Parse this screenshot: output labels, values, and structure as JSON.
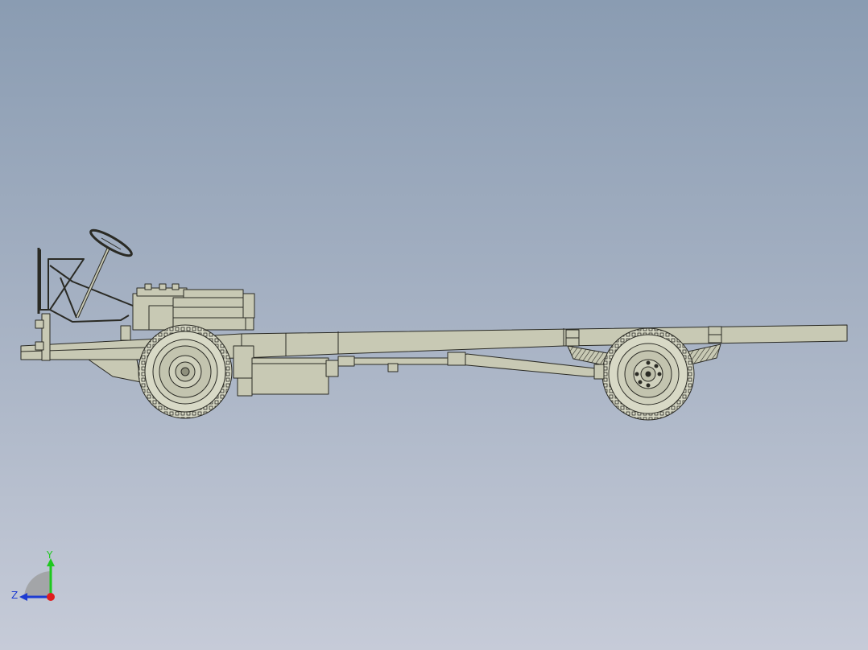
{
  "viewport": {
    "background_top": "#8a9cb2",
    "background_bottom": "#c6cbd8"
  },
  "model": {
    "part_color": "#c8c9b4",
    "shadow_color": "#8e8f7c",
    "edge_color": "#2a2a24"
  },
  "triad": {
    "x_label": "",
    "y_label": "Y",
    "z_label": "Z",
    "y_color": "#1ec81e",
    "z_color": "#1e3cd2",
    "x_color": "#e01e1e"
  }
}
